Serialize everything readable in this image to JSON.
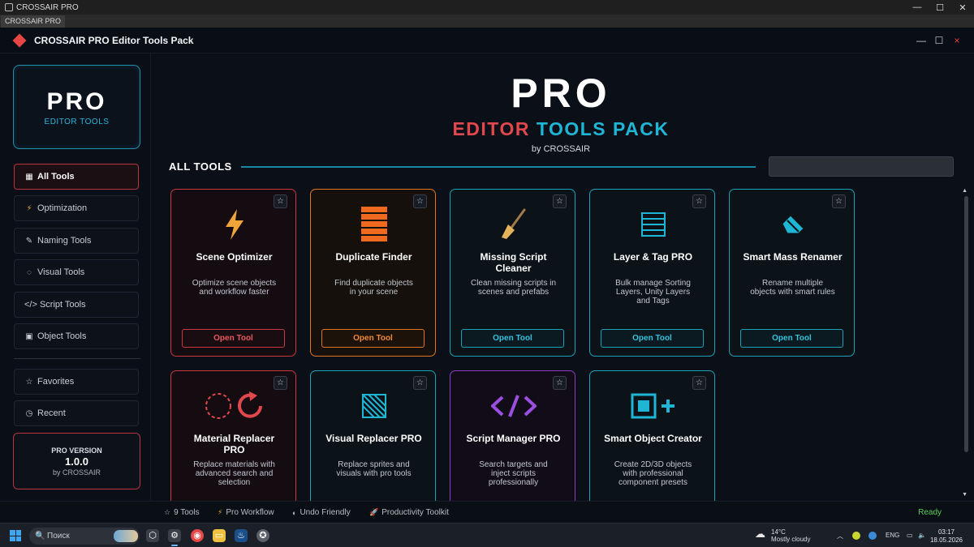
{
  "os": {
    "window_title": "CROSSAIR PRO",
    "tab_label": "CROSSAIR PRO",
    "controls": [
      "—",
      "☐",
      "✕"
    ]
  },
  "app": {
    "title": "CROSSAIR PRO Editor Tools Pack",
    "controls": {
      "minimize": "—",
      "maximize": "☐",
      "close": "×"
    }
  },
  "sidebar": {
    "brand": {
      "title": "PRO",
      "subtitle": "EDITOR TOOLS"
    },
    "items": [
      {
        "icon": "▦",
        "label": "All Tools",
        "active": true
      },
      {
        "icon": "⚡",
        "label": "Optimization"
      },
      {
        "icon": "✎",
        "label": "Naming Tools"
      },
      {
        "icon": "◌",
        "label": "Visual Tools"
      },
      {
        "icon": "",
        "label": "</> Script Tools"
      },
      {
        "icon": "▣",
        "label": "Object Tools"
      }
    ],
    "secondary": [
      {
        "icon": "☆",
        "label": "Favorites"
      },
      {
        "icon": "◷",
        "label": "Recent"
      }
    ],
    "version": {
      "label": "PRO VERSION",
      "number": "1.0.0",
      "by": "by CROSSAIR"
    }
  },
  "hero": {
    "title": "PRO",
    "subtitle_words": [
      "EDITOR",
      "TOOLS",
      "PACK"
    ],
    "by": "by CROSSAIR"
  },
  "section": {
    "title": "ALL TOOLS",
    "search_value": ""
  },
  "tools": [
    {
      "title": "Scene Optimizer",
      "description": "Optimize scene objects and workflow faster",
      "button": "Open Tool",
      "icon": "lightning-icon",
      "accent": "#c8383f"
    },
    {
      "title": "Duplicate Finder",
      "description": "Find duplicate objects in your scene",
      "button": "Open Tool",
      "icon": "stack-icon",
      "accent": "#e07621"
    },
    {
      "title": "Missing Script Cleaner",
      "description": "Clean missing scripts in scenes and prefabs",
      "button": "Open Tool",
      "icon": "broom-icon",
      "accent": "#1aa3b8"
    },
    {
      "title": "Layer & Tag PRO",
      "description": "Bulk manage Sorting Layers, Unity Layers and Tags",
      "button": "Open Tool",
      "icon": "layers-list-icon",
      "accent": "#1aa3b8"
    },
    {
      "title": "Smart Mass Renamer",
      "description": "Rename multiple objects with smart rules",
      "button": "Open Tool",
      "icon": "pencil-icon",
      "accent": "#1aa3b8"
    },
    {
      "title": "Material Replacer PRO",
      "description": "Replace materials with advanced search and selection",
      "icon": "replace-icon",
      "accent": "#c8383f"
    },
    {
      "title": "Visual Replacer PRO",
      "description": "Replace sprites and visuals with pro tools",
      "icon": "hatched-square-icon",
      "accent": "#1aa3b8"
    },
    {
      "title": "Script Manager PRO",
      "description": "Search targets and inject scripts professionally",
      "icon": "code-brackets-icon",
      "accent": "#8a3fc4"
    },
    {
      "title": "Smart Object Creator",
      "description": "Create 2D/3D objects with professional component presets",
      "icon": "add-object-icon",
      "accent": "#1aa3b8"
    }
  ],
  "status": {
    "items": [
      {
        "icon": "☆",
        "label": "9 Tools"
      },
      {
        "icon": "⚡",
        "label": "Pro Workflow"
      },
      {
        "icon": "◐",
        "label": "Undo Friendly"
      },
      {
        "icon": "🚀",
        "label": "Productivity Toolkit"
      }
    ],
    "ready": "Ready"
  },
  "taskbar": {
    "search_placeholder": "Поиск",
    "weather": {
      "temp": "14°C",
      "desc": "Mostly cloudy"
    },
    "lang": "ENG",
    "time": "03:17",
    "date": "18.05.2026"
  },
  "colors": {
    "red": "#c8383f",
    "orange": "#e07621",
    "teal": "#1aa3b8",
    "purple": "#8a3fc4",
    "ready_green": "#5bcf5b"
  }
}
